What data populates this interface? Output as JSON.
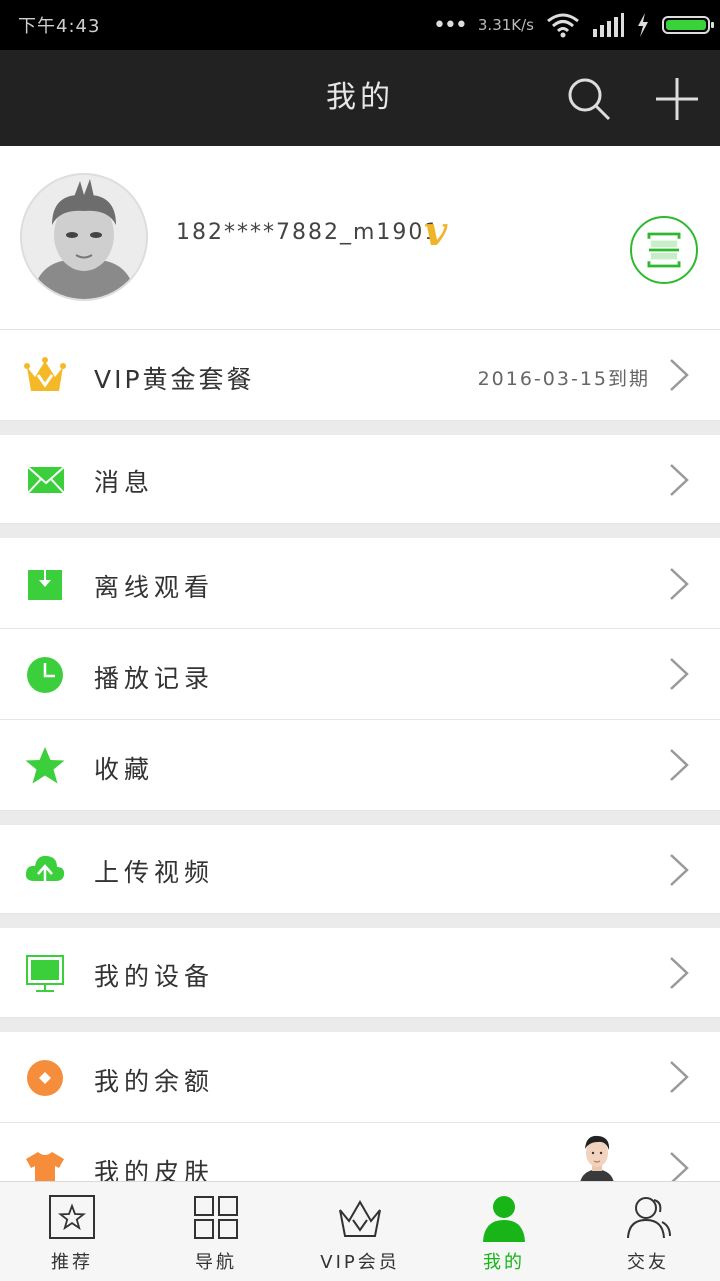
{
  "status_bar": {
    "time": "下午4:43",
    "network_speed": "3.31K/s",
    "battery_color": "#3ad23a"
  },
  "header": {
    "title": "我的",
    "search_icon": "search-icon",
    "add_icon": "plus-icon"
  },
  "profile": {
    "username": "182****7882_m1901",
    "vip_mark": "v",
    "scan_icon": "scan-icon",
    "accent": "#2db92d"
  },
  "menu": {
    "vip": {
      "label": "VIP黄金套餐",
      "expiry": "2016-03-15到期",
      "icon": "crown-icon"
    },
    "messages": {
      "label": "消息",
      "icon": "mail-icon"
    },
    "offline": {
      "label": "离线观看",
      "icon": "download-icon"
    },
    "history": {
      "label": "播放记录",
      "icon": "clock-icon"
    },
    "favorites": {
      "label": "收藏",
      "icon": "star-icon"
    },
    "upload": {
      "label": "上传视频",
      "icon": "cloud-upload-icon"
    },
    "devices": {
      "label": "我的设备",
      "icon": "monitor-icon"
    },
    "balance": {
      "label": "我的余额",
      "icon": "coin-icon"
    },
    "skin": {
      "label": "我的皮肤",
      "icon": "shirt-icon"
    }
  },
  "tabbar": {
    "items": [
      {
        "label": "推荐",
        "icon": "star-box-icon"
      },
      {
        "label": "导航",
        "icon": "grid-icon"
      },
      {
        "label": "VIP会员",
        "icon": "crown-outline-icon"
      },
      {
        "label": "我的",
        "icon": "person-icon",
        "active": true
      },
      {
        "label": "交友",
        "icon": "friends-icon"
      }
    ],
    "active_color": "#18b418"
  }
}
